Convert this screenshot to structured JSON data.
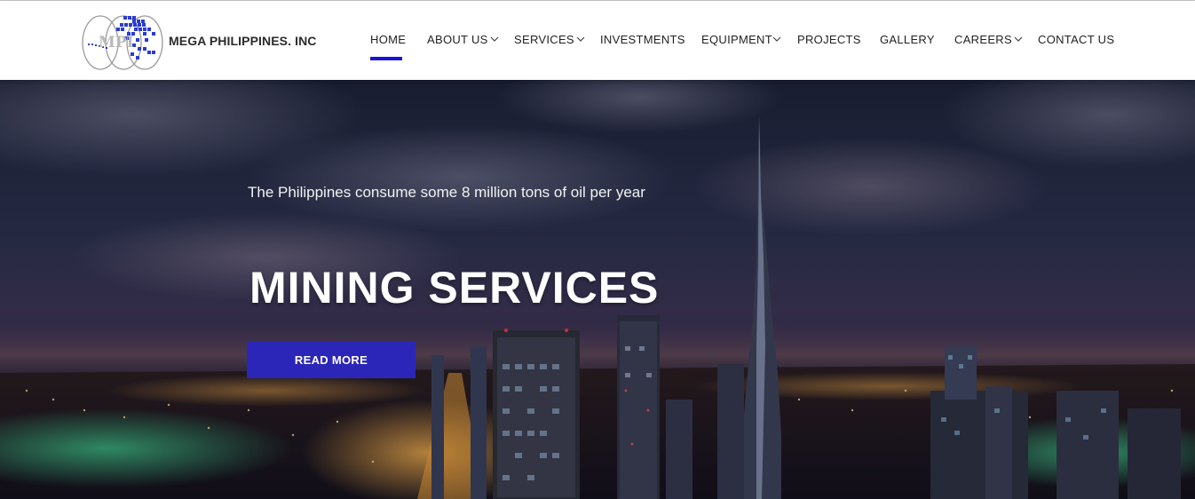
{
  "brand": {
    "logo_icon": "globe-map-logo",
    "logo_text": "MPI",
    "name": "MEGA PHILIPPINES. INC"
  },
  "nav": {
    "items": [
      {
        "label": "HOME",
        "active": true,
        "dropdown": false
      },
      {
        "label": "ABOUT US",
        "active": false,
        "dropdown": true
      },
      {
        "label": "SERVICES",
        "active": false,
        "dropdown": true
      },
      {
        "label": "INVESTMENTS",
        "active": false,
        "dropdown": false
      },
      {
        "label": "EQUIPMENT",
        "active": false,
        "dropdown": true
      },
      {
        "label": "PROJECTS",
        "active": false,
        "dropdown": false
      },
      {
        "label": "GALLERY",
        "active": false,
        "dropdown": false
      },
      {
        "label": "CAREERS",
        "active": false,
        "dropdown": true
      },
      {
        "label": "CONTACT US",
        "active": false,
        "dropdown": false
      }
    ],
    "chevron_icon": "chevron-down-icon",
    "accent": "#1a14d6"
  },
  "hero": {
    "tagline": "The Philippines consume some 8 million tons of oil per year",
    "title": "MINING SERVICES",
    "button_label": "READ MORE",
    "button_color": "#2b26b8",
    "background": "night-city-skyline-image"
  }
}
